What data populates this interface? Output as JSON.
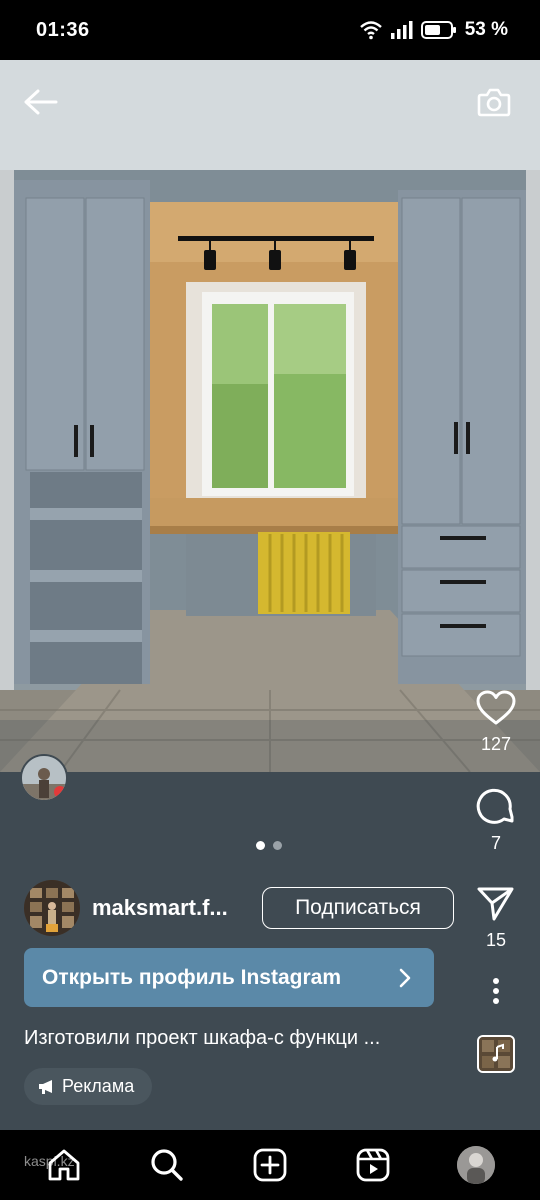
{
  "status_bar": {
    "time": "01:36",
    "battery": "53 %"
  },
  "post": {
    "author_name": "maksmart.f...",
    "subscribe_label": "Подписаться",
    "open_profile_label": "Открыть профиль Instagram",
    "caption": "Изготовили проект шкафа-с функци ...",
    "ad_label": "Реклама",
    "carousel": {
      "total": 2,
      "current": 1
    }
  },
  "actions": {
    "likes": "127",
    "comments": "7",
    "shares": "15"
  },
  "watermark": "kaspi.kz",
  "icons": {
    "back": "back-arrow-icon",
    "camera": "camera-icon",
    "like": "heart-icon",
    "comment": "comment-icon",
    "share": "send-icon",
    "more": "more-icon",
    "ad": "megaphone-icon",
    "home": "home-icon",
    "search": "search-icon",
    "create": "plus-square-icon",
    "reels": "reels-icon"
  },
  "colors": {
    "profile_button": "#5b89a8",
    "background": "#3f4a52"
  }
}
